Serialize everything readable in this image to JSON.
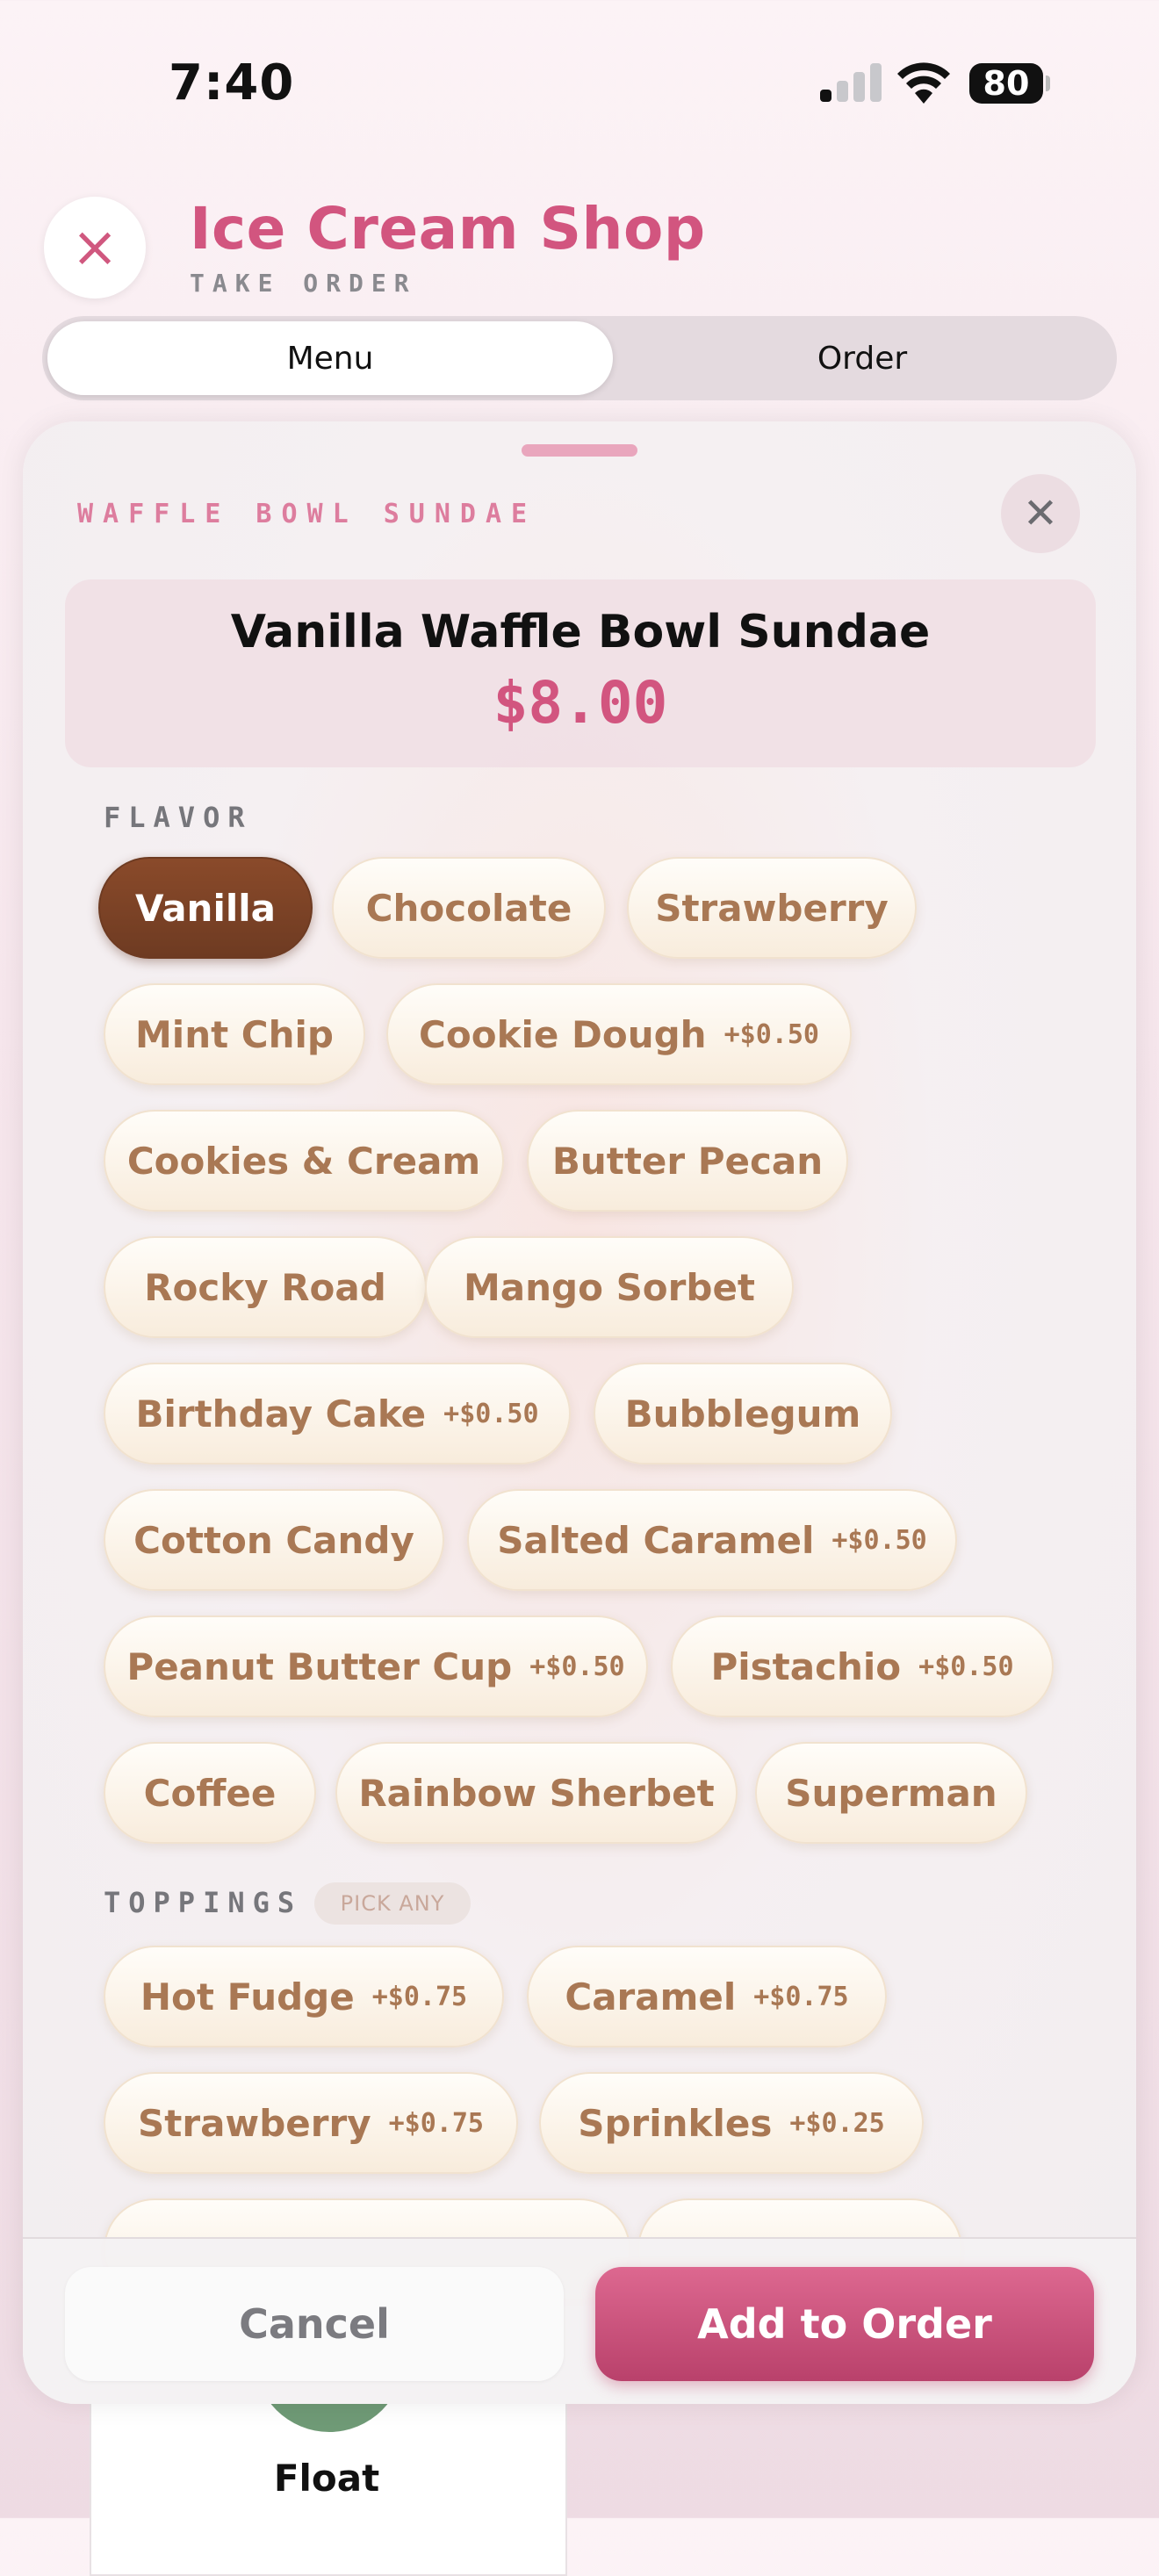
{
  "status_bar": {
    "time": "7:40",
    "battery": "80"
  },
  "header": {
    "title": "Ice Cream Shop",
    "subtitle": "TAKE ORDER",
    "close_icon": "×"
  },
  "tabs": [
    {
      "label": "Menu",
      "active": true
    },
    {
      "label": "Order",
      "active": false
    }
  ],
  "sheet": {
    "title": "WAFFLE BOWL SUNDAE",
    "close_icon": "✕",
    "product_name": "Vanilla Waffle Bowl Sundae",
    "price": "$8.00"
  },
  "flavor_section": {
    "label": "FLAVOR",
    "options": [
      {
        "label": "Vanilla",
        "upcharge": "",
        "selected": true
      },
      {
        "label": "Chocolate",
        "upcharge": ""
      },
      {
        "label": "Strawberry",
        "upcharge": ""
      },
      {
        "label": "Mint Chip",
        "upcharge": ""
      },
      {
        "label": "Cookie Dough",
        "upcharge": "+$0.50"
      },
      {
        "label": "Cookies & Cream",
        "upcharge": ""
      },
      {
        "label": "Butter Pecan",
        "upcharge": ""
      },
      {
        "label": "Rocky Road",
        "upcharge": ""
      },
      {
        "label": "Mango Sorbet",
        "upcharge": ""
      },
      {
        "label": "Birthday Cake",
        "upcharge": "+$0.50"
      },
      {
        "label": "Bubblegum",
        "upcharge": ""
      },
      {
        "label": "Cotton Candy",
        "upcharge": ""
      },
      {
        "label": "Salted Caramel",
        "upcharge": "+$0.50"
      },
      {
        "label": "Peanut Butter Cup",
        "upcharge": "+$0.50"
      },
      {
        "label": "Pistachio",
        "upcharge": "+$0.50"
      },
      {
        "label": "Coffee",
        "upcharge": ""
      },
      {
        "label": "Rainbow Sherbet",
        "upcharge": ""
      },
      {
        "label": "Superman",
        "upcharge": ""
      }
    ]
  },
  "toppings_section": {
    "label": "TOPPINGS",
    "badge": "PICK ANY",
    "options": [
      {
        "label": "Hot Fudge",
        "upcharge": "+$0.75"
      },
      {
        "label": "Caramel",
        "upcharge": "+$0.75"
      },
      {
        "label": "Strawberry",
        "upcharge": "+$0.75"
      },
      {
        "label": "Sprinkles",
        "upcharge": "+$0.25"
      }
    ]
  },
  "footer": {
    "cancel_label": "Cancel",
    "add_label": "Add to Order"
  },
  "background_card": {
    "label": "Float"
  },
  "colors": {
    "accent": "#d2557f",
    "chip_text": "#a97854",
    "selected_chip": "#7a4126"
  }
}
